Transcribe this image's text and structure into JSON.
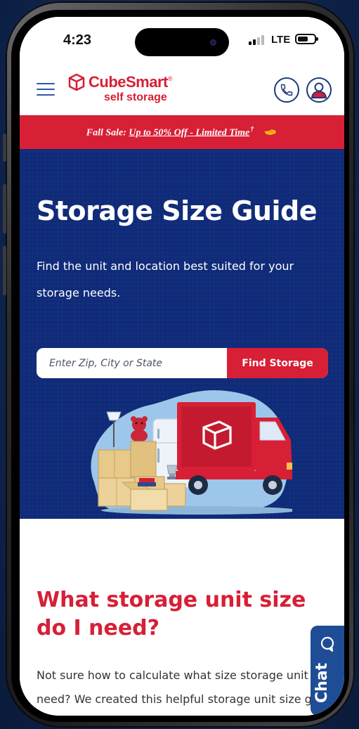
{
  "status_bar": {
    "time": "4:23",
    "network": "LTE"
  },
  "header": {
    "menu_icon": "hamburger-menu-icon",
    "logo_name": "CubeSmart",
    "logo_mark": "®",
    "logo_subtitle": "self storage",
    "phone_icon": "phone-icon",
    "account_icon": "user-account-icon"
  },
  "promo": {
    "label": "Fall Sale:",
    "link": "Up to 50% Off - Limited Time",
    "mark": "†",
    "icon": "pointing-hand-icon"
  },
  "hero": {
    "title": "Storage Size Guide",
    "description": "Find the unit and location best suited for your storage needs.",
    "search_placeholder": "Enter Zip, City or State",
    "search_button": "Find Storage"
  },
  "content": {
    "heading": "What storage unit size do I need?",
    "body_line1": "Not sure how to calculate what size storage unit y",
    "body_line2": "need? We created this helpful storage unit size gu"
  },
  "chat": {
    "label": "Chat",
    "icon": "chat-bubble-icon"
  },
  "colors": {
    "brand_red": "#d71f36",
    "hero_blue": "#0f2a78",
    "chat_blue": "#1f4d95"
  }
}
